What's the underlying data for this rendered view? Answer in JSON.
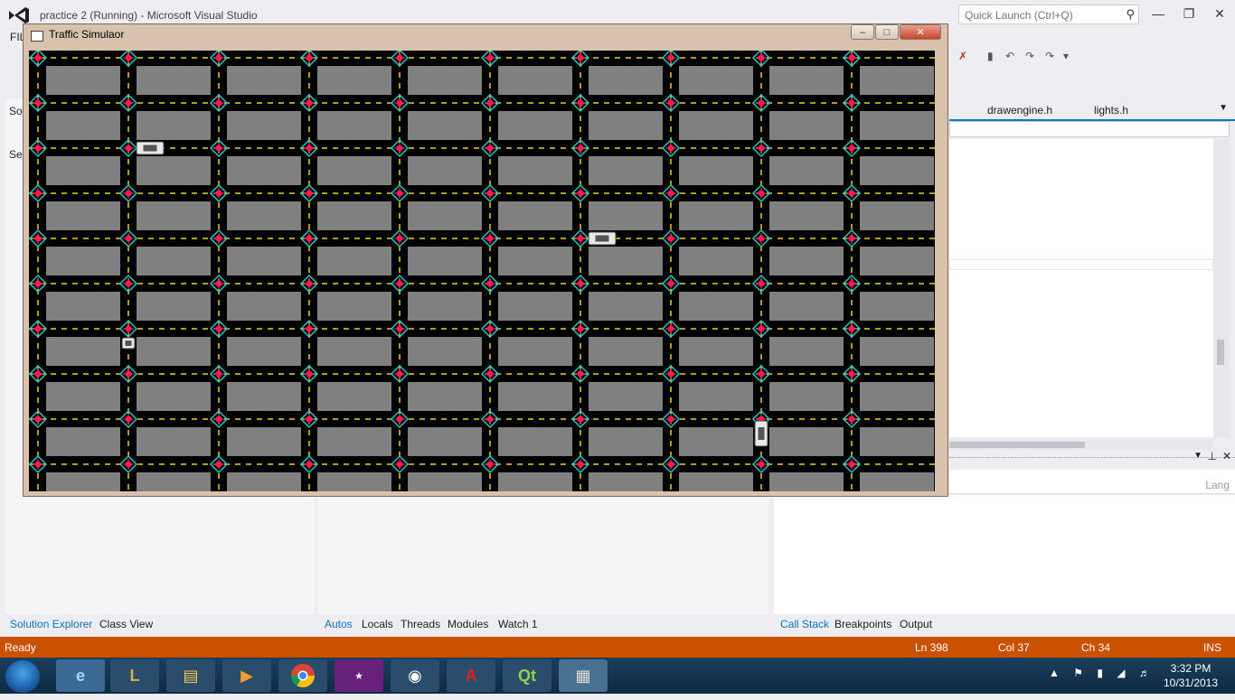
{
  "vs": {
    "title": "practice 2 (Running) - Microsoft Visual Studio",
    "quick_launch_placeholder": "Quick Launch (Ctrl+Q)",
    "menu_stub": "FIL",
    "doc_tabs": [
      "drawengine.h",
      "lights.h"
    ],
    "left_stubs": [
      "Solu",
      "Sea"
    ],
    "lang_label": "Lang"
  },
  "traffic_window": {
    "title": "Traffic Simulaor",
    "grid": {
      "columns": 10,
      "rows": 10
    },
    "cars": [
      {
        "orientation": "horizontal",
        "road_row": 2,
        "between_cols": [
          1,
          2
        ]
      },
      {
        "orientation": "horizontal",
        "road_row": 4,
        "between_cols": [
          6,
          7
        ]
      },
      {
        "orientation": "vertical",
        "road_col": 1,
        "between_rows": [
          6,
          7
        ]
      },
      {
        "orientation": "vertical",
        "road_col": 8,
        "between_rows": [
          8,
          9
        ]
      }
    ]
  },
  "bottom_tabs": {
    "left": [
      "Solution Explorer",
      "Class View"
    ],
    "middle": [
      "Autos",
      "Locals",
      "Threads",
      "Modules",
      "Watch 1"
    ],
    "right": [
      "Call Stack",
      "Breakpoints",
      "Output"
    ]
  },
  "status": {
    "text": "Ready",
    "line": "Ln 398",
    "col": "Col 37",
    "ch": "Ch 34",
    "mode": "INS"
  },
  "taskbar": {
    "time": "3:32 PM",
    "date": "10/31/2013"
  },
  "colors": {
    "status_bar": "#ca5100",
    "accent": "#007acc",
    "road": "#000000",
    "block": "#808080",
    "lane_marking": "#e6d21e",
    "light_red": "#ff1a55",
    "light_teal": "#27c7c7"
  }
}
